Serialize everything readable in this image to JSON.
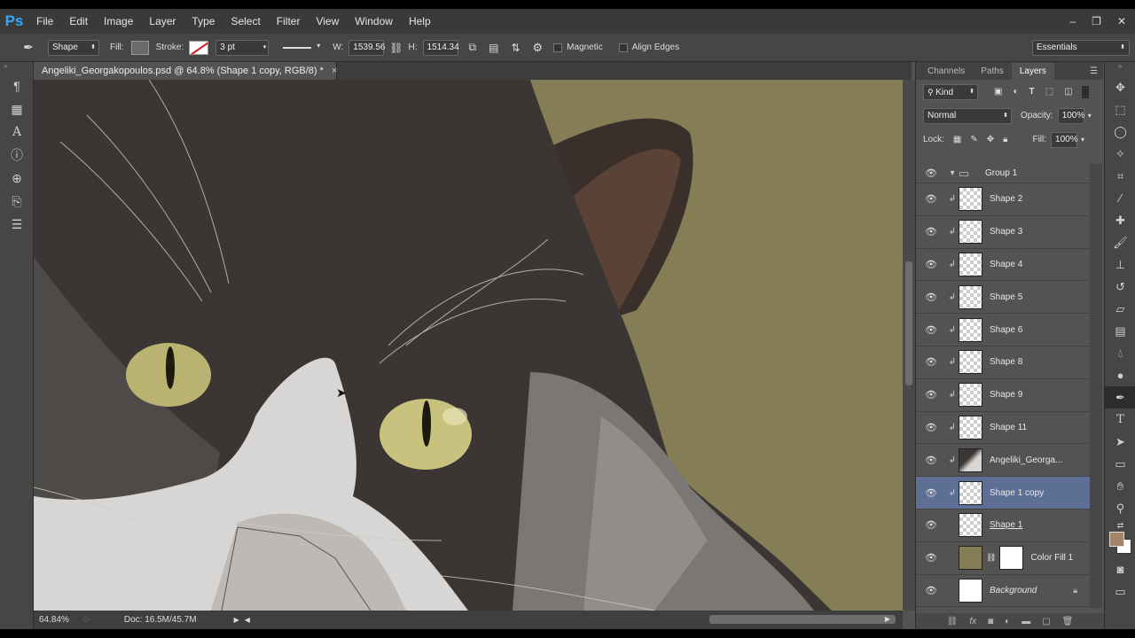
{
  "app": {
    "logo": "Ps"
  },
  "menu": [
    "File",
    "Edit",
    "Image",
    "Layer",
    "Type",
    "Select",
    "Filter",
    "View",
    "Window",
    "Help"
  ],
  "window_controls": {
    "minimize": "–",
    "restore": "❐",
    "close": "✕"
  },
  "options": {
    "tool_mode": "Shape",
    "fill_label": "Fill:",
    "stroke_label": "Stroke:",
    "stroke_width": "3 pt",
    "w_label": "W:",
    "w_value": "1539.56",
    "h_label": "H:",
    "h_value": "1514.34",
    "magnetic_label": "Magnetic",
    "align_edges_label": "Align Edges",
    "workspace": "Essentials"
  },
  "document": {
    "tab_title": "Angeliki_Georgakopoulos.psd @ 64.8% (Shape 1 copy, RGB/8) *",
    "close": "×",
    "zoom": "64.84%",
    "doc_size": "Doc: 16.5M/45.7M"
  },
  "panels": {
    "tabs": [
      "Channels",
      "Paths",
      "Layers"
    ],
    "active_tab": "Layers",
    "filter_kind": "Kind",
    "blend_mode": "Normal",
    "opacity_label": "Opacity:",
    "opacity_value": "100%",
    "lock_label": "Lock:",
    "fill_label": "Fill:",
    "fill_value": "100%"
  },
  "layers": [
    {
      "name": "Group 1",
      "type": "group"
    },
    {
      "name": "Shape 2",
      "type": "shape",
      "clipped": true
    },
    {
      "name": "Shape 3",
      "type": "shape",
      "clipped": true
    },
    {
      "name": "Shape 4",
      "type": "shape",
      "clipped": true
    },
    {
      "name": "Shape 5",
      "type": "shape",
      "clipped": true
    },
    {
      "name": "Shape 6",
      "type": "shape",
      "clipped": true
    },
    {
      "name": "Shape 8",
      "type": "shape",
      "clipped": true
    },
    {
      "name": "Shape 9",
      "type": "shape",
      "clipped": true
    },
    {
      "name": "Shape 11",
      "type": "shape",
      "clipped": true
    },
    {
      "name": "Angeliki_Georga...",
      "type": "photo",
      "clipped": true
    },
    {
      "name": "Shape 1 copy",
      "type": "shape",
      "clipped": true,
      "selected": true
    },
    {
      "name": "Shape 1",
      "type": "shape",
      "underline": true
    },
    {
      "name": "Color Fill 1",
      "type": "fill"
    },
    {
      "name": "Background",
      "type": "background",
      "italic": true,
      "locked": true
    }
  ],
  "colors": {
    "accent_selected": "#5e6f95",
    "canvas_bg": "#847d56",
    "foreground": "#a08568",
    "background": "#ffffff"
  }
}
